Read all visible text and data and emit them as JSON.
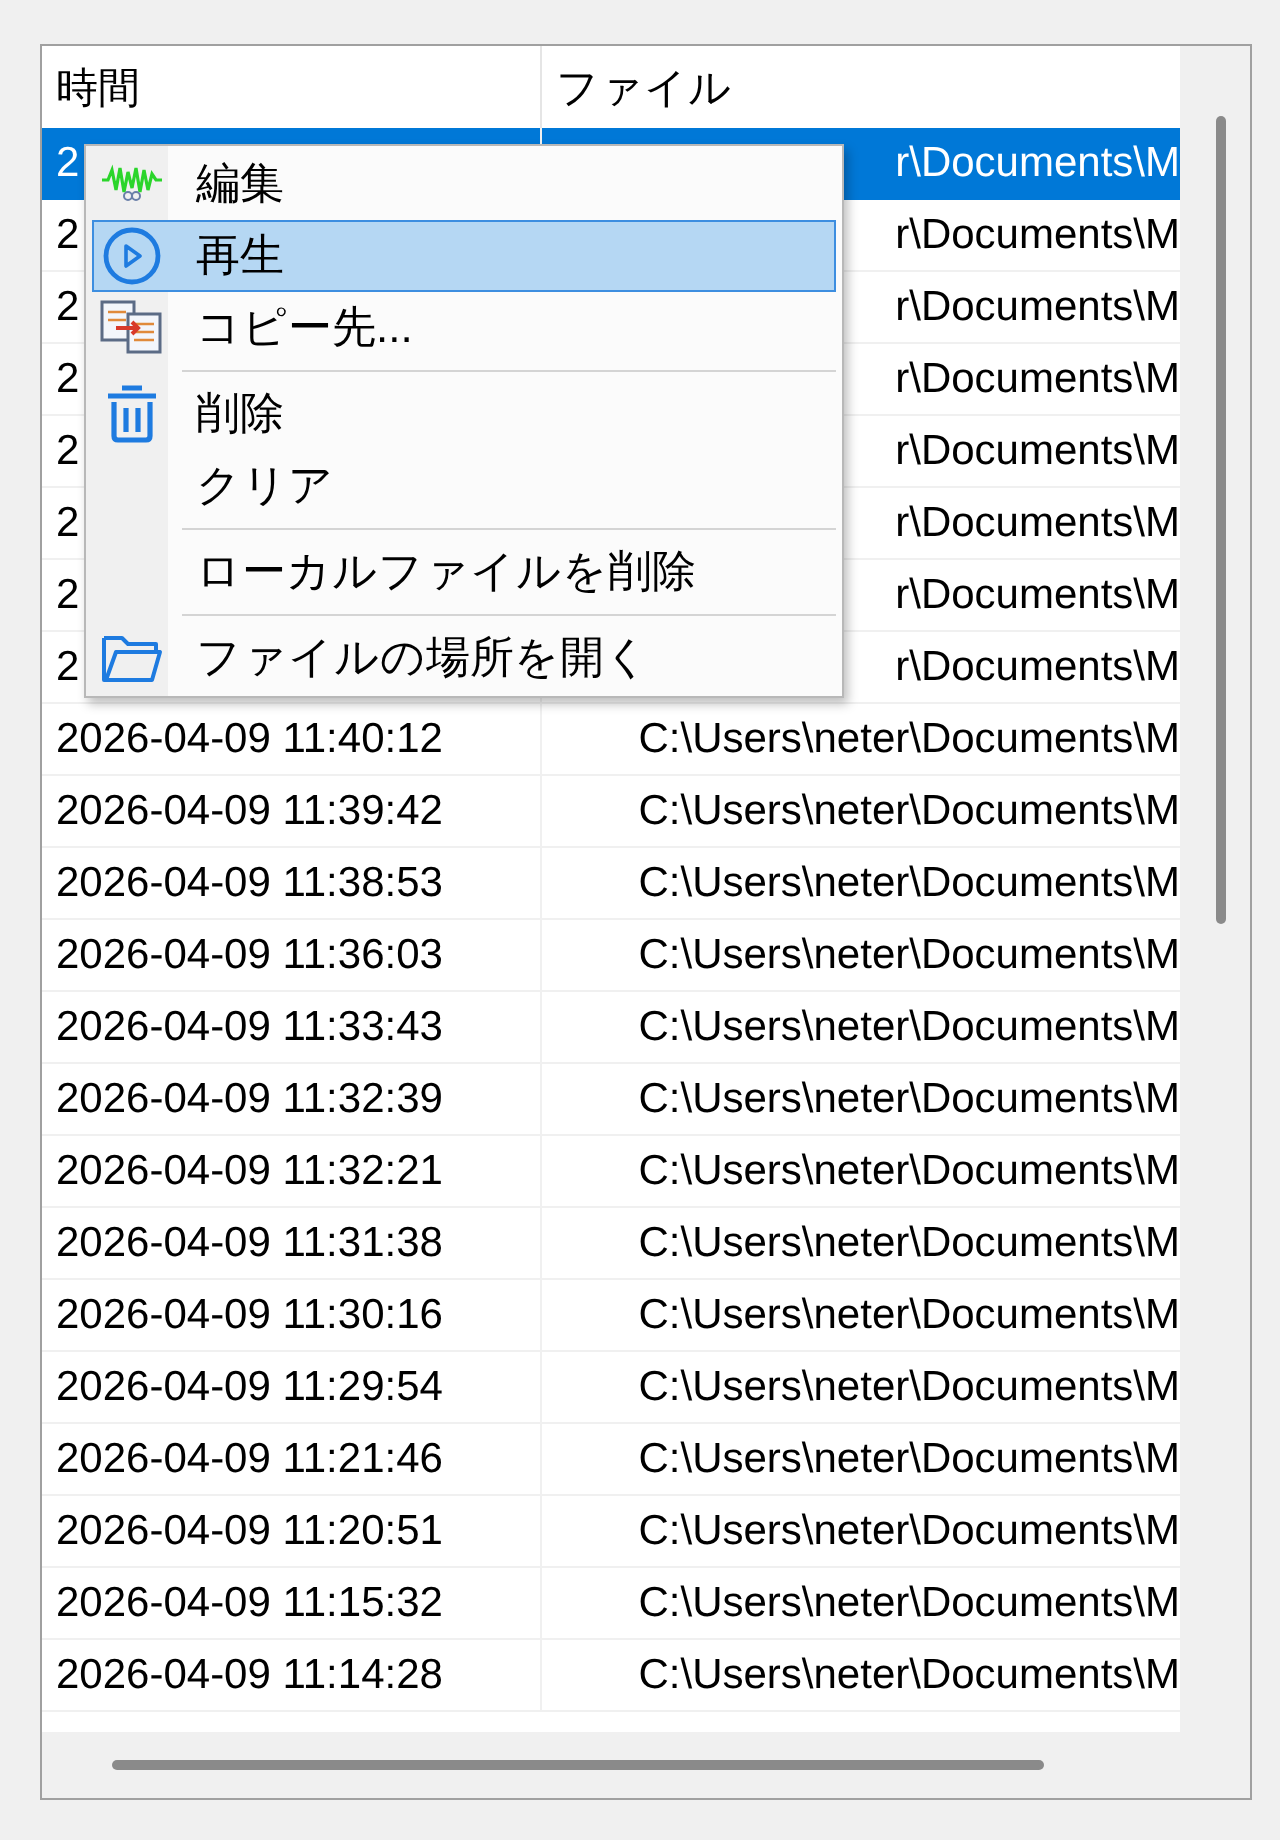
{
  "table": {
    "columns": [
      "時間",
      "ファイル"
    ],
    "rows": [
      {
        "cells": [
          "2",
          "r\\Documents\\M"
        ],
        "selected": true
      },
      {
        "cells": [
          "2",
          "r\\Documents\\M"
        ],
        "selected": false
      },
      {
        "cells": [
          "2",
          "r\\Documents\\M"
        ],
        "selected": false
      },
      {
        "cells": [
          "2",
          "r\\Documents\\M"
        ],
        "selected": false
      },
      {
        "cells": [
          "2",
          "r\\Documents\\M"
        ],
        "selected": false
      },
      {
        "cells": [
          "2",
          "r\\Documents\\M"
        ],
        "selected": false
      },
      {
        "cells": [
          "2",
          "r\\Documents\\M"
        ],
        "selected": false
      },
      {
        "cells": [
          "2",
          "r\\Documents\\M"
        ],
        "selected": false
      },
      {
        "cells": [
          "2026-04-09 11:40:12",
          "C:\\Users\\neter\\Documents\\M"
        ],
        "selected": false
      },
      {
        "cells": [
          "2026-04-09 11:39:42",
          "C:\\Users\\neter\\Documents\\M"
        ],
        "selected": false
      },
      {
        "cells": [
          "2026-04-09 11:38:53",
          "C:\\Users\\neter\\Documents\\M"
        ],
        "selected": false
      },
      {
        "cells": [
          "2026-04-09 11:36:03",
          "C:\\Users\\neter\\Documents\\M"
        ],
        "selected": false
      },
      {
        "cells": [
          "2026-04-09 11:33:43",
          "C:\\Users\\neter\\Documents\\M"
        ],
        "selected": false
      },
      {
        "cells": [
          "2026-04-09 11:32:39",
          "C:\\Users\\neter\\Documents\\M"
        ],
        "selected": false
      },
      {
        "cells": [
          "2026-04-09 11:32:21",
          "C:\\Users\\neter\\Documents\\M"
        ],
        "selected": false
      },
      {
        "cells": [
          "2026-04-09 11:31:38",
          "C:\\Users\\neter\\Documents\\M"
        ],
        "selected": false
      },
      {
        "cells": [
          "2026-04-09 11:30:16",
          "C:\\Users\\neter\\Documents\\M"
        ],
        "selected": false
      },
      {
        "cells": [
          "2026-04-09 11:29:54",
          "C:\\Users\\neter\\Documents\\M"
        ],
        "selected": false
      },
      {
        "cells": [
          "2026-04-09 11:21:46",
          "C:\\Users\\neter\\Documents\\M"
        ],
        "selected": false
      },
      {
        "cells": [
          "2026-04-09 11:20:51",
          "C:\\Users\\neter\\Documents\\M"
        ],
        "selected": false
      },
      {
        "cells": [
          "2026-04-09 11:15:32",
          "C:\\Users\\neter\\Documents\\M"
        ],
        "selected": false
      },
      {
        "cells": [
          "2026-04-09 11:14:28",
          "C:\\Users\\neter\\Documents\\M"
        ],
        "selected": false
      }
    ]
  },
  "context_menu": {
    "items": [
      {
        "kind": "item",
        "label": "編集",
        "selected": false
      },
      {
        "kind": "item",
        "label": "再生",
        "selected": true
      },
      {
        "kind": "item",
        "label": "コピー先...",
        "selected": false
      },
      {
        "kind": "separator"
      },
      {
        "kind": "item",
        "label": "削除",
        "selected": false
      },
      {
        "kind": "item",
        "label": "クリア",
        "selected": false
      },
      {
        "kind": "separator"
      },
      {
        "kind": "item",
        "label": "ローカルファイルを削除",
        "selected": false
      },
      {
        "kind": "separator"
      },
      {
        "kind": "item",
        "label": "ファイルの場所を開く",
        "selected": false
      }
    ]
  }
}
